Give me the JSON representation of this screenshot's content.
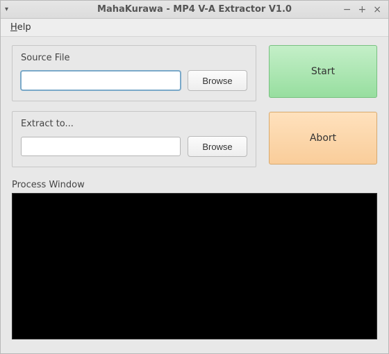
{
  "window": {
    "title": "MahaKurawa - MP4 V-A Extractor V1.0"
  },
  "menu": {
    "help": {
      "underline": "H",
      "rest": "elp"
    }
  },
  "source": {
    "label": "Source File",
    "value": "",
    "browse": "Browse"
  },
  "extract": {
    "label": "Extract to...",
    "value": "",
    "browse": "Browse"
  },
  "buttons": {
    "start": "Start",
    "abort": "Abort"
  },
  "process": {
    "label": "Process Window",
    "output": ""
  }
}
